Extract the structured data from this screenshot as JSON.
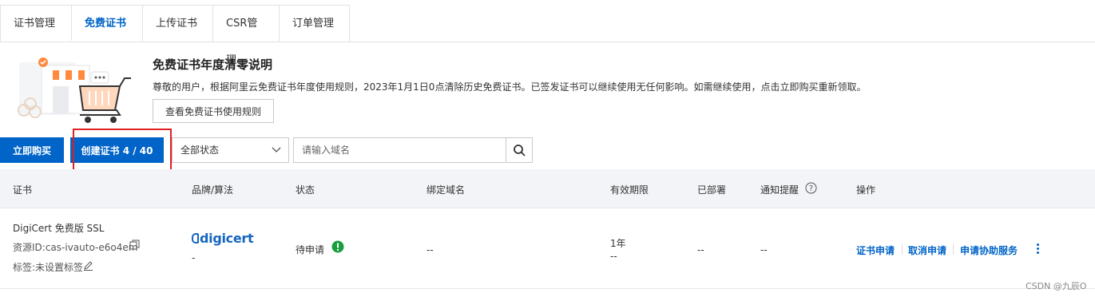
{
  "tabs": [
    {
      "label": "证书管理"
    },
    {
      "label": "免费证书"
    },
    {
      "label": "上传证书"
    },
    {
      "label": "CSR管理"
    },
    {
      "label": "订单管理"
    }
  ],
  "notice": {
    "title": "免费证书年度清零说明",
    "text": "尊敬的用户，根据阿里云免费证书年度使用规则，2023年1月1日0点清除历史免费证书。已签发证书可以继续使用无任何影响。如需继续使用，点击立即购买重新领取。",
    "rules_button": "查看免费证书使用规则"
  },
  "toolbar": {
    "buy_label": "立即购买",
    "create_label": "创建证书 4 / 40",
    "status_select": "全部状态",
    "search_placeholder": "请输入域名"
  },
  "table": {
    "headers": {
      "cert": "证书",
      "brand": "品牌/算法",
      "status": "状态",
      "domain": "绑定域名",
      "validity": "有效期限",
      "deployed": "已部署",
      "notify": "通知提醒",
      "ops": "操作"
    },
    "rows": [
      {
        "name": "DigiCert 免费版 SSL",
        "resource_id": "资源ID:cas-ivauto-e6o4em",
        "tag": "标签:未设置标签",
        "brand_logo": "digicert",
        "algo": "-",
        "status": "待申请",
        "domain": "--",
        "validity_line1": "1年",
        "validity_line2": "--",
        "deployed": "--",
        "notify": "--",
        "actions": [
          "证书申请",
          "取消申请",
          "申请协助服务"
        ]
      }
    ]
  },
  "watermark": "CSDN @九辰O",
  "colors": {
    "primary": "#0064c8",
    "highlight": "#e02020",
    "success": "#1a9e3f"
  }
}
